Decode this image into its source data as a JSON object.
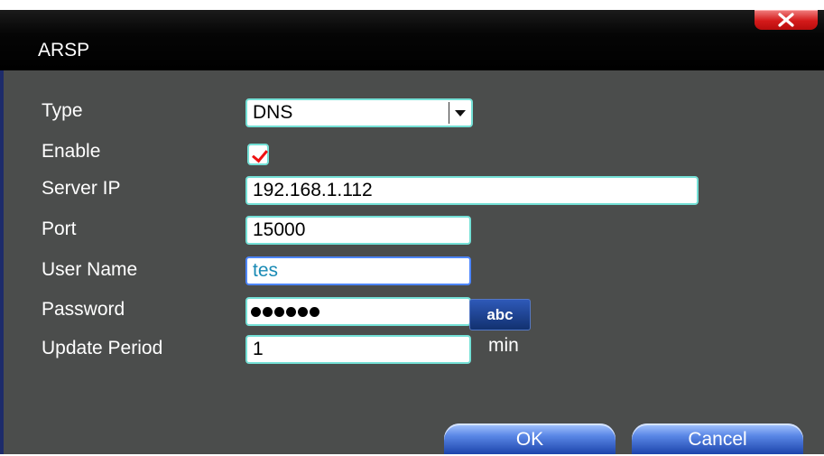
{
  "window": {
    "title": "ARSP"
  },
  "close_icon": "close-icon",
  "form": {
    "type": {
      "label": "Type",
      "value": "DNS"
    },
    "enable": {
      "label": "Enable",
      "checked": true
    },
    "server_ip": {
      "label": "Server IP",
      "value": "192.168.1.112"
    },
    "port": {
      "label": "Port",
      "value": "15000"
    },
    "user_name": {
      "label": "User Name",
      "value": "tes"
    },
    "password": {
      "label": "Password",
      "masked_length": 6,
      "toggle_label": "abc"
    },
    "update_period": {
      "label": "Update Period",
      "value": "1",
      "unit": "min"
    }
  },
  "buttons": {
    "ok": "OK",
    "cancel": "Cancel"
  },
  "colors": {
    "field_border": "#74e0d6",
    "focus_border": "#4d86ff",
    "panel_bg": "#4b4d4c",
    "check": "#ee1111"
  }
}
